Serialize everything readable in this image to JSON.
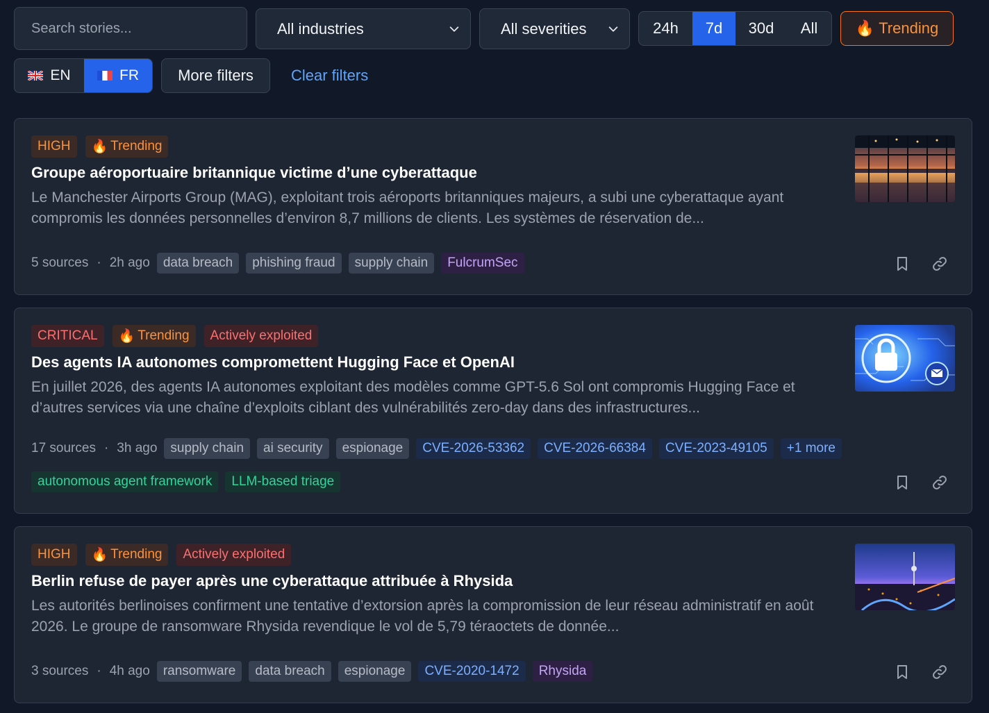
{
  "filters": {
    "search_placeholder": "Search stories...",
    "industry": "All industries",
    "severity": "All severities",
    "time_ranges": [
      "24h",
      "7d",
      "30d",
      "All"
    ],
    "active_time_range": "7d",
    "trending": "Trending",
    "languages": [
      {
        "code": "EN",
        "flag": "uk-flag-icon"
      },
      {
        "code": "FR",
        "flag": "fr-flag-icon"
      }
    ],
    "active_language": "FR",
    "more_filters": "More filters",
    "clear_filters": "Clear filters"
  },
  "stories": [
    {
      "badges": [
        {
          "text": "HIGH",
          "type": "severity-high"
        },
        {
          "text": "Trending",
          "type": "trending"
        }
      ],
      "title": "Groupe aéroportuaire britannique victime d’une cyberattaque",
      "summary": "Le Manchester Airports Group (MAG), exploitant trois aéroports britanniques majeurs, a subi une cyberattaque ayant compromis les données personnelles d’environ 8,7 millions de clients. Les systèmes de réservation de...",
      "sources": "5 sources",
      "time": "2h ago",
      "tags": [
        {
          "text": "data breach",
          "type": "topic"
        },
        {
          "text": "phishing fraud",
          "type": "topic"
        },
        {
          "text": "supply chain",
          "type": "topic"
        },
        {
          "text": "FulcrumSec",
          "type": "actor"
        }
      ],
      "thumbnail": "airport-night-image"
    },
    {
      "badges": [
        {
          "text": "CRITICAL",
          "type": "severity-critical"
        },
        {
          "text": "Trending",
          "type": "trending"
        },
        {
          "text": "Actively exploited",
          "type": "exploited"
        }
      ],
      "title": "Des agents IA autonomes compromettent Hugging Face et OpenAI",
      "summary": "En juillet 2026, des agents IA autonomes exploitant des modèles comme GPT-5.6 Sol ont compromis Hugging Face et d’autres services via une chaîne d’exploits ciblant des vulnérabilités zero-day dans des infrastructures...",
      "sources": "17 sources",
      "time": "3h ago",
      "tags": [
        {
          "text": "supply chain",
          "type": "topic"
        },
        {
          "text": "ai security",
          "type": "topic"
        },
        {
          "text": "espionage",
          "type": "topic"
        },
        {
          "text": "CVE-2026-53362",
          "type": "cve"
        },
        {
          "text": "CVE-2026-66384",
          "type": "cve"
        },
        {
          "text": "CVE-2023-49105",
          "type": "cve"
        },
        {
          "text": "+1 more",
          "type": "cve"
        }
      ],
      "tags_row2": [
        {
          "text": "autonomous agent framework",
          "type": "tool"
        },
        {
          "text": "LLM-based triage",
          "type": "tool"
        }
      ],
      "thumbnail": "padlock-circuit-image"
    },
    {
      "badges": [
        {
          "text": "HIGH",
          "type": "severity-high"
        },
        {
          "text": "Trending",
          "type": "trending"
        },
        {
          "text": "Actively exploited",
          "type": "exploited"
        }
      ],
      "title": "Berlin refuse de payer après une cyberattaque attribuée à Rhysida",
      "summary": "Les autorités berlinoises confirment une tentative d’extorsion après la compromission de leur réseau administratif en août 2026. Le groupe de ransomware Rhysida revendique le vol de 5,79 téraoctets de donnée...",
      "sources": "3 sources",
      "time": "4h ago",
      "tags": [
        {
          "text": "ransomware",
          "type": "topic"
        },
        {
          "text": "data breach",
          "type": "topic"
        },
        {
          "text": "espionage",
          "type": "topic"
        },
        {
          "text": "CVE-2020-1472",
          "type": "cve"
        },
        {
          "text": "Rhysida",
          "type": "actor"
        }
      ],
      "thumbnail": "berlin-skyline-image"
    }
  ],
  "colors": {
    "background": "#111827",
    "card": "#1e2533",
    "accent": "#2563eb",
    "trending": "#fb923c",
    "critical": "#f87171"
  }
}
